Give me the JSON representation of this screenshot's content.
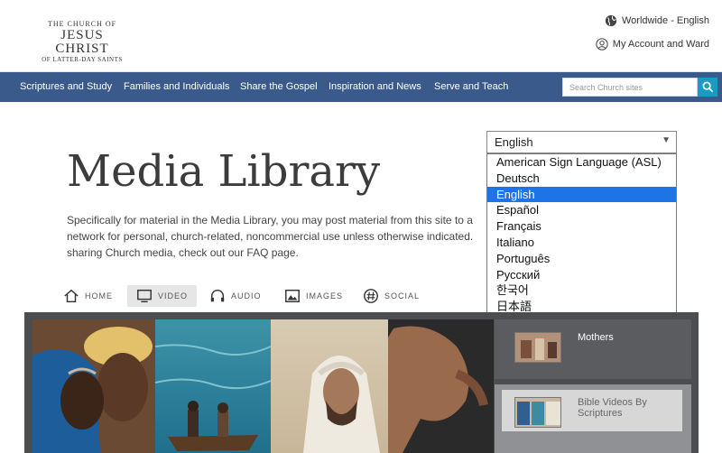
{
  "header": {
    "logo_line1": "THE CHURCH OF",
    "logo_line2": "JESUS CHRIST",
    "logo_line3": "OF LATTER-DAY SAINTS",
    "locale_link": "Worldwide - English",
    "account_link": "My Account and Ward"
  },
  "nav": {
    "items": [
      "Scriptures and Study",
      "Families and Individuals",
      "Share the Gospel",
      "Inspiration and News",
      "Serve and Teach"
    ],
    "search_placeholder": "Search Church sites"
  },
  "page": {
    "title": "Media Library",
    "intro": "Specifically for material in the Media Library, you may post material from this site to a network for personal, church-related, noncommercial use unless otherwise indicated. sharing Church media, check out our FAQ page."
  },
  "language_select": {
    "selected": "English",
    "options": [
      "American Sign Language (ASL)",
      "Deutsch",
      "English",
      "Español",
      "Français",
      "Italiano",
      "Português",
      "Русский",
      "한국어",
      "日本語"
    ]
  },
  "media_tabs": {
    "home": "HOME",
    "video": "VIDEO",
    "audio": "AUDIO",
    "images": "IMAGES",
    "social": "SOCIAL"
  },
  "side_cards": {
    "card1": "Mothers",
    "card2": "Bible Videos By Scriptures"
  },
  "colors": {
    "nav_bg": "#3a5a8c",
    "search_button": "#1b9bc4",
    "option_highlight": "#1e74e6",
    "gallery_bg": "#4b4d50"
  }
}
